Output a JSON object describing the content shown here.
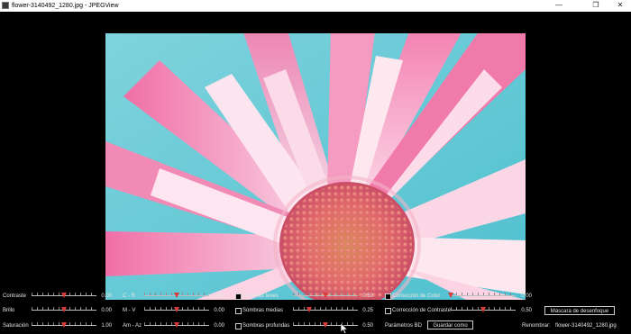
{
  "window": {
    "title": "flower-3140492_1280.jpg - JPEGView",
    "minimize_glyph": "—",
    "restore_glyph": "❐",
    "close_glyph": "✕"
  },
  "controls": {
    "contraste": {
      "label": "Contraste",
      "value": "0.00",
      "level": 0.5
    },
    "brillo": {
      "label": "Brillo",
      "value": "0.00",
      "level": 0.5
    },
    "saturacion": {
      "label": "Saturación",
      "value": "1.00",
      "level": 0.5
    },
    "c_r": {
      "label": "C - R",
      "value": "0.00",
      "level": 0.5
    },
    "m_v": {
      "label": "M - V",
      "value": "0.00",
      "level": 0.5
    },
    "am_az": {
      "label": "Am - Az",
      "value": "0.00",
      "level": 0.5
    },
    "sombras_leves": {
      "label": "Sombras leves",
      "value": "0.50",
      "level": 0.5,
      "checked": false
    },
    "sombras_medias": {
      "label": "Sombras medias",
      "value": "0.25",
      "level": 0.25,
      "checked": false
    },
    "sombras_profundas": {
      "label": "Sombras profundas",
      "value": "0.50",
      "level": 0.5,
      "checked": false
    },
    "correccion_color": {
      "label": "Corrección de Color",
      "value": "0.00",
      "level": 0.0,
      "checked": false
    },
    "correccion_contraste": {
      "label": "Corrección de Contraste",
      "value": "0.50",
      "level": 0.5,
      "checked": false
    },
    "parametros_bd": {
      "label": "Parámetros BD"
    },
    "guardar_como": {
      "label": "Guardar como"
    },
    "mascara": {
      "label": "Máscara de desenfoque"
    },
    "renombrar": {
      "label": "Renombrar:",
      "value": "flower-3140492_1280.jpg"
    }
  }
}
